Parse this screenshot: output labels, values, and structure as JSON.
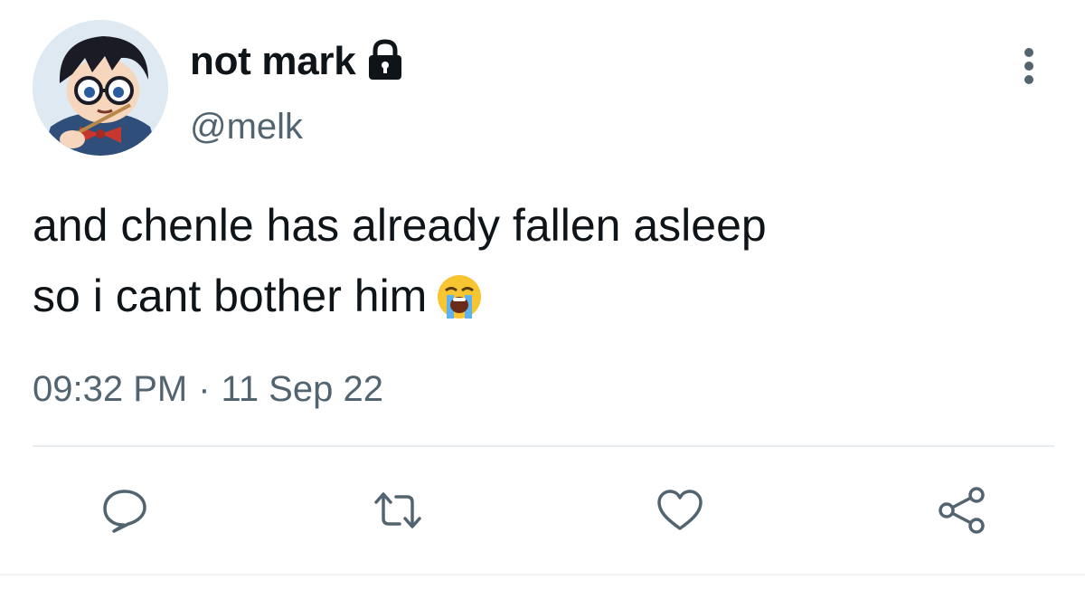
{
  "user": {
    "display_name": "not mark",
    "handle": "@melk",
    "avatar_icon": "avatar-anime-character",
    "verified_icon": "lock-icon"
  },
  "tweet": {
    "lines": [
      "and chenle has already fallen asleep",
      "so i cant bother him"
    ],
    "emoji": "😭",
    "time": "09:32 PM",
    "separator": "·",
    "date": "11 Sep 22"
  },
  "actions": [
    {
      "name": "reply",
      "icon": "speech-bubble-icon"
    },
    {
      "name": "retweet",
      "icon": "retweet-icon"
    },
    {
      "name": "like",
      "icon": "heart-icon"
    },
    {
      "name": "share",
      "icon": "share-icon"
    }
  ],
  "colors": {
    "text": "#0f1419",
    "secondary": "#536471",
    "divider": "#e6ecf0"
  }
}
